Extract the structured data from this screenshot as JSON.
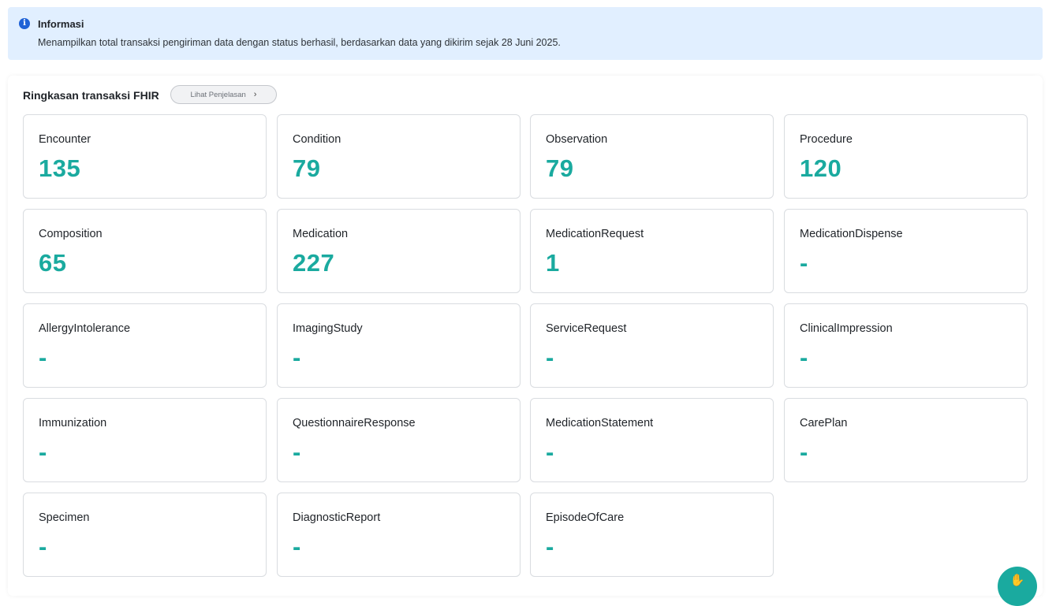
{
  "info": {
    "title": "Informasi",
    "message": "Menampilkan total transaksi pengiriman data dengan status berhasil, berdasarkan data yang dikirim sejak 28 Juni 2025."
  },
  "summary": {
    "title": "Ringkasan transaksi FHIR",
    "explain_label": "Lihat Penjelasan",
    "accent_color": "#1aaa9f",
    "cards": [
      {
        "label": "Encounter",
        "value": "135"
      },
      {
        "label": "Condition",
        "value": "79"
      },
      {
        "label": "Observation",
        "value": "79"
      },
      {
        "label": "Procedure",
        "value": "120"
      },
      {
        "label": "Composition",
        "value": "65"
      },
      {
        "label": "Medication",
        "value": "227"
      },
      {
        "label": "MedicationRequest",
        "value": "1"
      },
      {
        "label": "MedicationDispense",
        "value": "-"
      },
      {
        "label": "AllergyIntolerance",
        "value": "-"
      },
      {
        "label": "ImagingStudy",
        "value": "-"
      },
      {
        "label": "ServiceRequest",
        "value": "-"
      },
      {
        "label": "ClinicalImpression",
        "value": "-"
      },
      {
        "label": "Immunization",
        "value": "-"
      },
      {
        "label": "QuestionnaireResponse",
        "value": "-"
      },
      {
        "label": "MedicationStatement",
        "value": "-"
      },
      {
        "label": "CarePlan",
        "value": "-"
      },
      {
        "label": "Specimen",
        "value": "-"
      },
      {
        "label": "DiagnosticReport",
        "value": "-"
      },
      {
        "label": "EpisodeOfCare",
        "value": "-"
      }
    ]
  },
  "icons": {
    "info": "info-icon",
    "chevron": "chevron-right-icon",
    "chat": "chat-hand-icon"
  }
}
